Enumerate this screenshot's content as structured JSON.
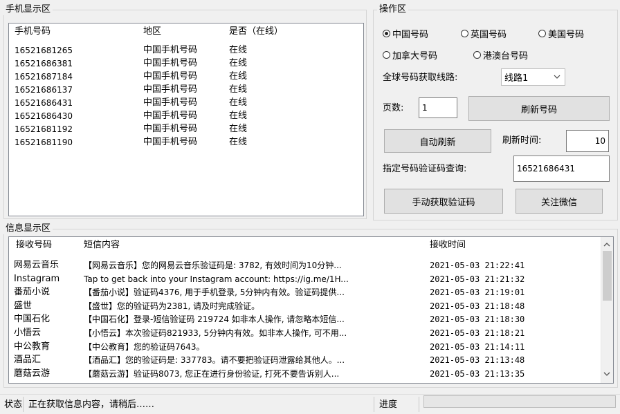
{
  "phone_area": {
    "title": "手机显示区",
    "columns": [
      "手机号码",
      "地区",
      "是否（在线）"
    ],
    "rows": [
      {
        "number": "16521681265",
        "region": "中国手机号码",
        "status": "在线"
      },
      {
        "number": "16521686381",
        "region": "中国手机号码",
        "status": "在线"
      },
      {
        "number": "16521687184",
        "region": "中国手机号码",
        "status": "在线"
      },
      {
        "number": "16521686137",
        "region": "中国手机号码",
        "status": "在线"
      },
      {
        "number": "16521686431",
        "region": "中国手机号码",
        "status": "在线"
      },
      {
        "number": "16521686430",
        "region": "中国手机号码",
        "status": "在线"
      },
      {
        "number": "16521681192",
        "region": "中国手机号码",
        "status": "在线"
      },
      {
        "number": "16521681190",
        "region": "中国手机号码",
        "status": "在线"
      }
    ]
  },
  "operation": {
    "title": "操作区",
    "radios": [
      {
        "label": "中国号码",
        "checked": true
      },
      {
        "label": "英国号码",
        "checked": false
      },
      {
        "label": "美国号码",
        "checked": false
      },
      {
        "label": "加拿大号码",
        "checked": false
      },
      {
        "label": "港澳台号码",
        "checked": false
      }
    ],
    "route_label": "全球号码获取线路:",
    "route_value": "线路1",
    "pages_label": "页数:",
    "pages_value": "1",
    "refresh_button": "刷新号码",
    "auto_refresh_button": "自动刷新",
    "refresh_time_label": "刷新时间:",
    "refresh_time_value": "10",
    "query_label": "指定号码验证码查询:",
    "query_value": "16521686431",
    "manual_button": "手动获取验证码",
    "follow_button": "关注微信"
  },
  "info_area": {
    "title": "信息显示区",
    "columns": [
      "接收号码",
      "短信内容",
      "接收时间"
    ],
    "rows": [
      {
        "sender": "网易云音乐",
        "content": "【网易云音乐】您的网易云音乐验证码是: 3782, 有效时间为10分钟...",
        "time": "2021-05-03 21:22:41"
      },
      {
        "sender": "Instagram",
        "content": "Tap to get back into your Instagram account: https://ig.me/1H...",
        "time": "2021-05-03 21:21:32"
      },
      {
        "sender": "番茄小说",
        "content": "【番茄小说】验证码4376, 用于手机登录, 5分钟内有效。验证码提供...",
        "time": "2021-05-03 21:19:01"
      },
      {
        "sender": "盛世",
        "content": "【盛世】您的验证码为2381, 请及时完成验证。",
        "time": "2021-05-03 21:18:48"
      },
      {
        "sender": "中国石化",
        "content": "【中国石化】登录-短信验证码 219724 如非本人操作, 请忽略本短信...",
        "time": "2021-05-03 21:18:30"
      },
      {
        "sender": "小悟云",
        "content": "【小悟云】本次验证码821933, 5分钟内有效。如非本人操作, 可不用...",
        "time": "2021-05-03 21:18:21"
      },
      {
        "sender": "中公教育",
        "content": "【中公教育】您的验证码7643。",
        "time": "2021-05-03 21:14:11"
      },
      {
        "sender": "酒品汇",
        "content": "【酒品汇】您的验证码是: 337783。请不要把验证码泄露给其他人。...",
        "time": "2021-05-03 21:13:48"
      },
      {
        "sender": "蘑菇云游",
        "content": "【蘑菇云游】验证码8073, 您正在进行身份验证, 打死不要告诉别人...",
        "time": "2021-05-03 21:13:35"
      }
    ]
  },
  "status_bar": {
    "label": "状态",
    "message": "正在获取信息内容，请稍后……",
    "progress_label": "进度",
    "progress": 0
  }
}
